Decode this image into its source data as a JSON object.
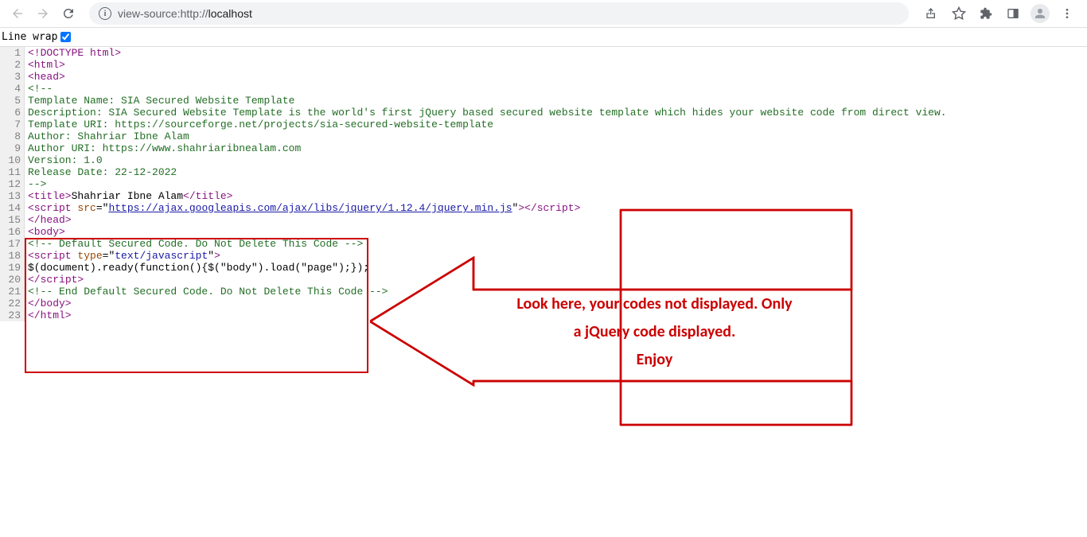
{
  "browser": {
    "url_prefix": "view-source:",
    "url_scheme": "http://",
    "url_host": "localhost"
  },
  "controls": {
    "linewrap_label": "Line wrap",
    "linewrap_checked": true
  },
  "lines": [
    {
      "n": "1",
      "segs": [
        {
          "t": "<!DOCTYPE html>",
          "c": "tag"
        }
      ]
    },
    {
      "n": "2",
      "segs": [
        {
          "t": "<html>",
          "c": "tag"
        }
      ]
    },
    {
      "n": "3",
      "segs": [
        {
          "t": "<head>",
          "c": "tag"
        }
      ]
    },
    {
      "n": "4",
      "segs": [
        {
          "t": "<!--",
          "c": "comment"
        }
      ]
    },
    {
      "n": "5",
      "segs": [
        {
          "t": "Template Name: SIA Secured Website Template",
          "c": "comment"
        }
      ]
    },
    {
      "n": "6",
      "segs": [
        {
          "t": "Description: SIA Secured Website Template is the world's first jQuery based secured website template which hides your website code from direct view.",
          "c": "comment"
        }
      ]
    },
    {
      "n": "7",
      "segs": [
        {
          "t": "Template URI: https://sourceforge.net/projects/sia-secured-website-template",
          "c": "comment"
        }
      ]
    },
    {
      "n": "8",
      "segs": [
        {
          "t": "Author: Shahriar Ibne Alam",
          "c": "comment"
        }
      ]
    },
    {
      "n": "9",
      "segs": [
        {
          "t": "Author URI: https://www.shahriaribnealam.com",
          "c": "comment"
        }
      ]
    },
    {
      "n": "10",
      "segs": [
        {
          "t": "Version: 1.0",
          "c": "comment"
        }
      ]
    },
    {
      "n": "11",
      "segs": [
        {
          "t": "Release Date: 22-12-2022",
          "c": "comment"
        }
      ]
    },
    {
      "n": "12",
      "segs": [
        {
          "t": "-->",
          "c": "comment"
        }
      ]
    },
    {
      "n": "13",
      "segs": [
        {
          "t": "<title>",
          "c": "tag"
        },
        {
          "t": "Shahriar Ibne Alam",
          "c": ""
        },
        {
          "t": "</title>",
          "c": "tag"
        }
      ]
    },
    {
      "n": "14",
      "segs": [
        {
          "t": "<script",
          "c": "tag"
        },
        {
          "t": " ",
          "c": ""
        },
        {
          "t": "src",
          "c": "attr-name"
        },
        {
          "t": "=\"",
          "c": ""
        },
        {
          "t": "https://ajax.googleapis.com/ajax/libs/jquery/1.12.4/jquery.min.js",
          "c": "link"
        },
        {
          "t": "\"",
          "c": ""
        },
        {
          "t": ">",
          "c": "tag"
        },
        {
          "t": "</scr",
          "c": "tag"
        },
        {
          "t": "ipt>",
          "c": "tag"
        }
      ]
    },
    {
      "n": "15",
      "segs": [
        {
          "t": "</head>",
          "c": "tag"
        }
      ]
    },
    {
      "n": "16",
      "segs": [
        {
          "t": "<body>",
          "c": "tag"
        }
      ]
    },
    {
      "n": "17",
      "segs": [
        {
          "t": "<!-- Default Secured Code. Do Not Delete This Code -->",
          "c": "comment"
        }
      ]
    },
    {
      "n": "18",
      "segs": [
        {
          "t": "<script",
          "c": "tag"
        },
        {
          "t": " ",
          "c": ""
        },
        {
          "t": "type",
          "c": "attr-name"
        },
        {
          "t": "=\"",
          "c": ""
        },
        {
          "t": "text/javascript",
          "c": "attr-val"
        },
        {
          "t": "\"",
          "c": ""
        },
        {
          "t": ">",
          "c": "tag"
        }
      ]
    },
    {
      "n": "19",
      "segs": [
        {
          "t": "$(document).ready(function(){$(\"body\").load(\"page\");});",
          "c": ""
        }
      ]
    },
    {
      "n": "20",
      "segs": [
        {
          "t": "</scr",
          "c": "tag"
        },
        {
          "t": "ipt>",
          "c": "tag"
        }
      ]
    },
    {
      "n": "21",
      "segs": [
        {
          "t": "<!-- End Default Secured Code. Do Not Delete This Code -->",
          "c": "comment"
        }
      ]
    },
    {
      "n": "22",
      "segs": [
        {
          "t": "</body>",
          "c": "tag"
        }
      ]
    },
    {
      "n": "23",
      "segs": [
        {
          "t": "</html>",
          "c": "tag"
        }
      ]
    }
  ],
  "annotation": {
    "line1": "Look here, your codes not displayed. Only",
    "line2": "a jQuery code displayed.",
    "line3": "Enjoy"
  }
}
